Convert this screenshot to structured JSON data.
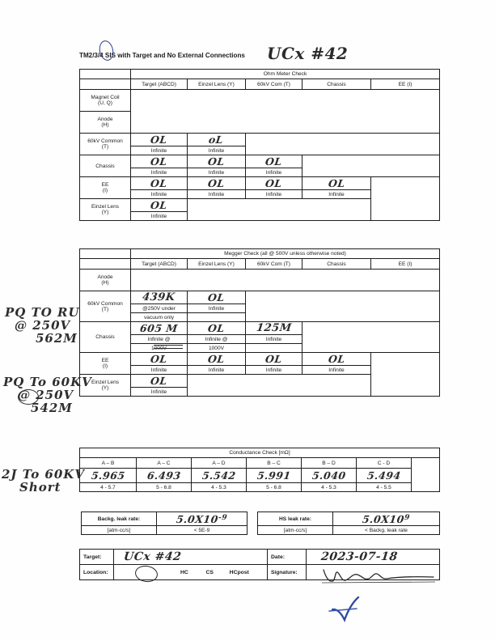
{
  "document": {
    "title": "TM2/3/4 SIS with Target and No External Connections",
    "title_handwritten": "UCx #42"
  },
  "ohm_meter": {
    "section_title": "Ohm Meter Check",
    "columns": [
      "Target (ABCD)",
      "Einzel Lens (Y)",
      "60kV Com (T)",
      "Chassis",
      "EE (I)"
    ],
    "rows": [
      {
        "label_line1": "Magnet Coil",
        "label_line2": "(U, Q)",
        "cells": []
      },
      {
        "label_line1": "Anode",
        "label_line2": "(H)",
        "cells": []
      },
      {
        "label_line1": "60kV Common",
        "label_line2": "(T)",
        "cells": [
          {
            "hw": "OL",
            "note": "Infinite"
          },
          {
            "hw": "oL",
            "note": "Infinite"
          }
        ]
      },
      {
        "label_line1": "Chassis",
        "label_line2": "",
        "cells": [
          {
            "hw": "OL",
            "note": "Infinite"
          },
          {
            "hw": "OL",
            "note": "Infinite"
          },
          {
            "hw": "OL",
            "note": "Infinite"
          }
        ]
      },
      {
        "label_line1": "EE",
        "label_line2": "(I)",
        "cells": [
          {
            "hw": "OL",
            "note": "Infinite"
          },
          {
            "hw": "OL",
            "note": "Infinite"
          },
          {
            "hw": "OL",
            "note": "Infinite"
          },
          {
            "hw": "OL",
            "note": "Infinite"
          }
        ]
      },
      {
        "label_line1": "Einzel Lens",
        "label_line2": "(Y)",
        "cells": [
          {
            "hw": "OL",
            "note": "Infinite"
          }
        ]
      }
    ]
  },
  "megger": {
    "section_title": "Megger Check (all @ 500V unless otherwise noted)",
    "columns": [
      "Target (ABCD)",
      "Einzel Lens (Y)",
      "60kV Com (T)",
      "Chassis",
      "EE (I)"
    ],
    "rows": [
      {
        "label_line1": "Anode",
        "label_line2": "(H)",
        "cells": []
      },
      {
        "label_line1": "60kV Common",
        "label_line2": "(T)",
        "cells": [
          {
            "hw": "439K",
            "note": "@250V under",
            "note2": "vacuum only"
          },
          {
            "hw": "OL",
            "note": "Infinite"
          }
        ]
      },
      {
        "label_line1": "Chassis",
        "label_line2": "",
        "cells": [
          {
            "hw": "605 M",
            "note": "Infinite @",
            "note2": "1000V",
            "struck": true
          },
          {
            "hw": "OL",
            "note": "Infinite @",
            "note2": "1000V"
          },
          {
            "hw": "125M",
            "note": "Infinite"
          }
        ]
      },
      {
        "label_line1": "EE",
        "label_line2": "(I)",
        "cells": [
          {
            "hw": "OL",
            "note": "Infinite"
          },
          {
            "hw": "OL",
            "note": "Infinite"
          },
          {
            "hw": "OL",
            "note": "Infinite"
          },
          {
            "hw": "OL",
            "note": "Infinite"
          }
        ]
      },
      {
        "label_line1": "Einzel Lens",
        "label_line2": "(Y)",
        "cells": [
          {
            "hw": "OL",
            "note": "Infinite"
          }
        ]
      }
    ]
  },
  "conductance": {
    "section_title": "Conductance Check [mΩ]",
    "columns": [
      "A – B",
      "A – C",
      "A – D",
      "B – C",
      "B – D",
      "C - D"
    ],
    "values": [
      "5.965",
      "6.493",
      "5.542",
      "5.991",
      "5.040",
      "5.494"
    ],
    "ranges": [
      "4 - 5.7",
      "5 - 6.8",
      "4 - 5.3",
      "5 - 6.8",
      "4 - 5.3",
      "4 - 5.5"
    ]
  },
  "leak": {
    "backg_label": "Backg. leak rate:",
    "backg_units": "[atm-cc/s]",
    "backg_value": "5.0X10",
    "backg_exponent": "-9",
    "backg_spec": "< 5E-9",
    "hs_label": "HS leak rate:",
    "hs_units": "[atm-cc/s]",
    "hs_value": "5.0X10",
    "hs_exponent": "9",
    "hs_spec": "< Backg. leak rate"
  },
  "footer": {
    "target_label": "Target:",
    "target_value": "UCx #42",
    "location_label": "Location:",
    "location_options": [
      "HC",
      "CS",
      "HCpost"
    ],
    "location_selected": "HC",
    "date_label": "Date:",
    "date_value": "2023-07-18",
    "signature_label": "Signature:"
  },
  "margin_notes": [
    {
      "lines": [
        "PQ TO RU",
        "@ 250V",
        "562M"
      ]
    },
    {
      "lines": [
        "PQ To 60KV",
        "@ 250V",
        "542M"
      ]
    },
    {
      "lines": [
        "2J To 60KV",
        "Short"
      ]
    }
  ]
}
